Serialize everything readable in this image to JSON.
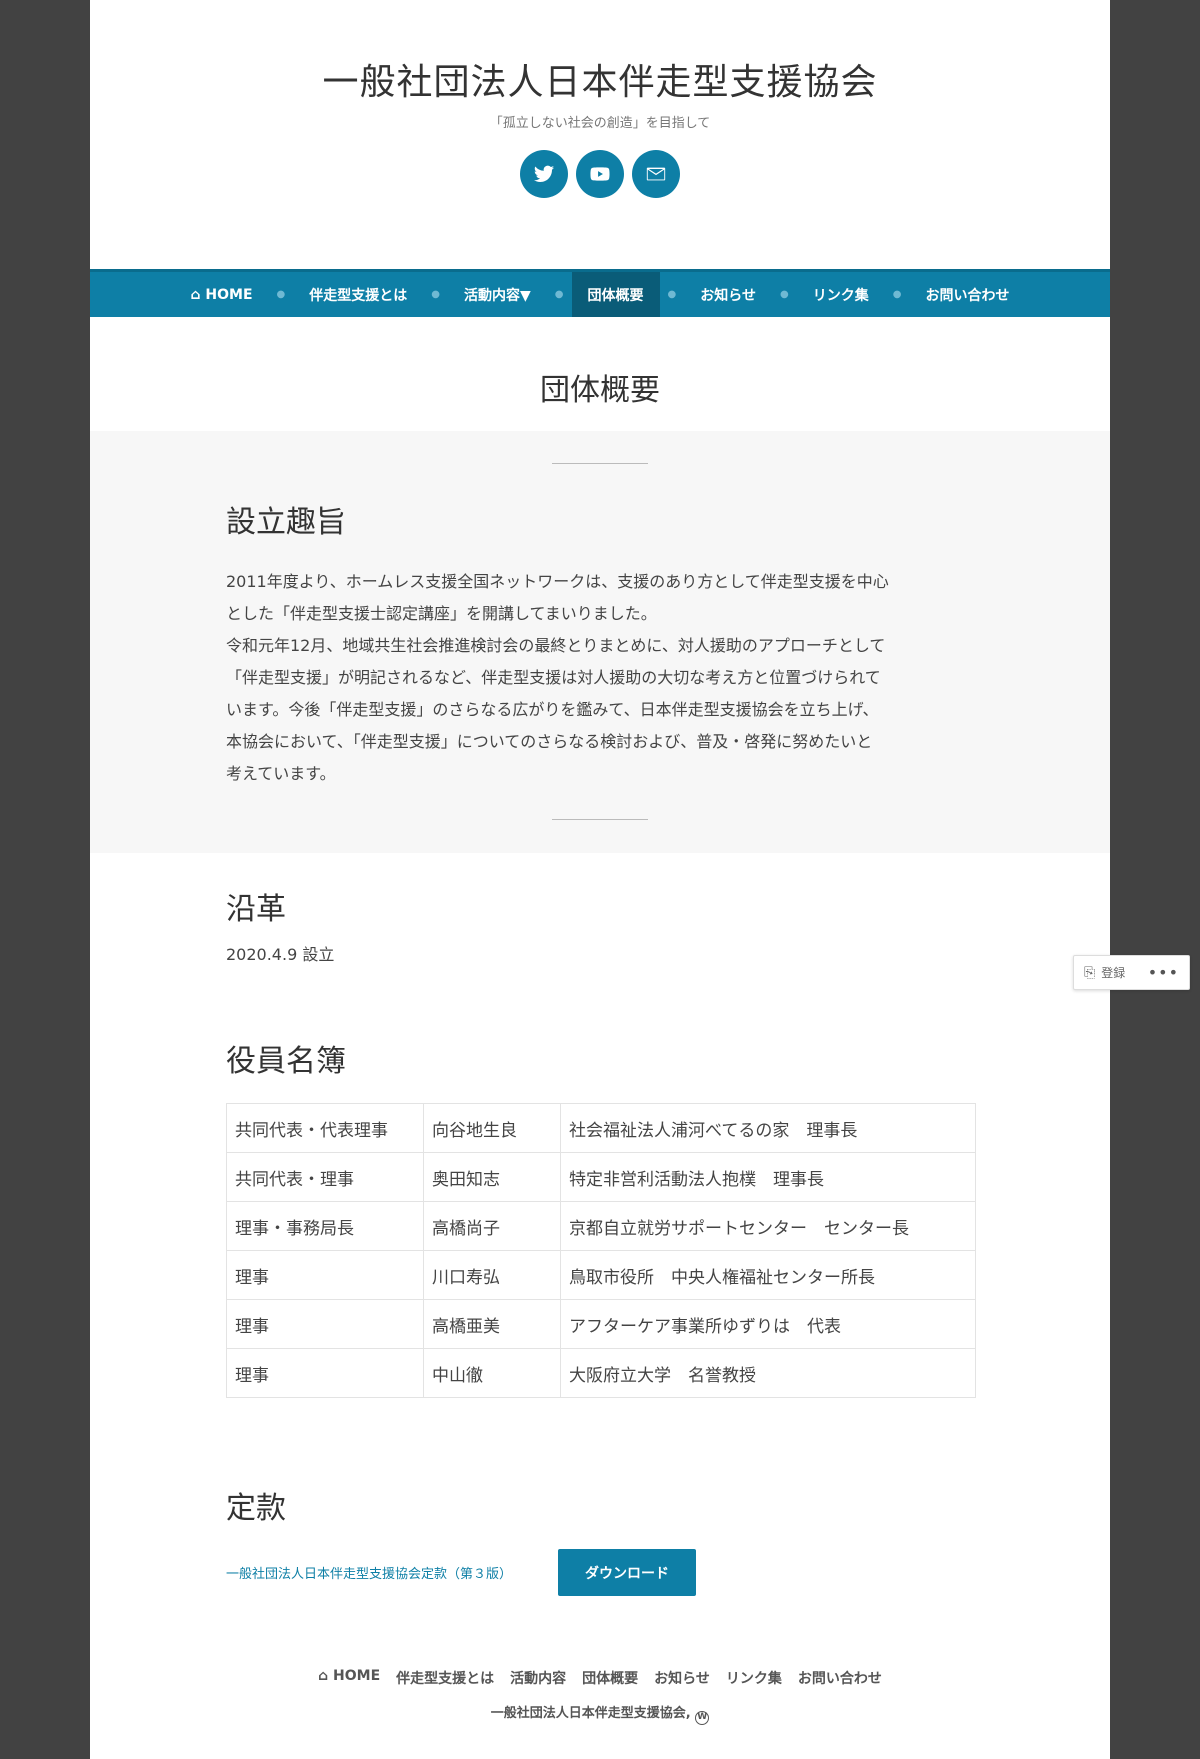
{
  "header": {
    "title": "一般社団法人日本伴走型支援協会",
    "tagline": "「孤立しない社会の創造」を目指して",
    "social": [
      "twitter-icon",
      "youtube-icon",
      "mail-icon"
    ]
  },
  "nav": {
    "items": [
      "⌂ HOME",
      "伴走型支援とは",
      "活動内容▼",
      "団体概要",
      "お知らせ",
      "リンク集",
      "お問い合わせ"
    ],
    "active": "団体概要"
  },
  "page_title": "団体概要",
  "intro": {
    "heading": "設立趣旨",
    "lines": [
      "2011年度より、ホームレス支援全国ネットワークは、支援のあり方として伴走型支援を中心",
      "とした「伴走型支援士認定講座」を開講してまいりました。",
      "令和元年12月、地域共生社会推進検討会の最終とりまとめに、対人援助のアプローチとして",
      "「伴走型支援」が明記されるなど、伴走型支援は対人援助の大切な考え方と位置づけられて",
      "います。今後「伴走型支援」のさらなる広がりを鑑みて、日本伴走型支援協会を立ち上げ、",
      "本協会において、「伴走型支援」についてのさらなる検討および、普及・啓発に努めたいと",
      "考えています。"
    ]
  },
  "history": {
    "heading": "沿革",
    "text": "2020.4.9 設立"
  },
  "officers": {
    "heading": "役員名簿",
    "rows": [
      [
        "共同代表・代表理事",
        "向谷地生良",
        "社会福祉法人浦河べてるの家　理事長"
      ],
      [
        "共同代表・理事",
        "奥田知志",
        "特定非営利活動法人抱樸　理事長"
      ],
      [
        "理事・事務局長",
        "高橋尚子",
        "京都自立就労サポートセンター　センター長"
      ],
      [
        "理事",
        "川口寿弘",
        "鳥取市役所　中央人権福祉センター所長"
      ],
      [
        "理事",
        "高橋亜美",
        "アフターケア事業所ゆずりは　代表"
      ],
      [
        "理事",
        "中山徹",
        "大阪府立大学　名誉教授"
      ]
    ]
  },
  "articles": {
    "heading": "定款",
    "link": "一般社団法人日本伴走型支援協会定款（第３版）",
    "button": "ダウンロード"
  },
  "footer": {
    "nav": [
      "⌂ HOME",
      "伴走型支援とは",
      "活動内容",
      "団体概要",
      "お知らせ",
      "リンク集",
      "お問い合わせ"
    ],
    "credit": "一般社団法人日本伴走型支援協会,",
    "wp_glyph": "W"
  },
  "follow": {
    "label": "登録",
    "reader_glyph": "⎘",
    "more_glyph": "•••"
  }
}
